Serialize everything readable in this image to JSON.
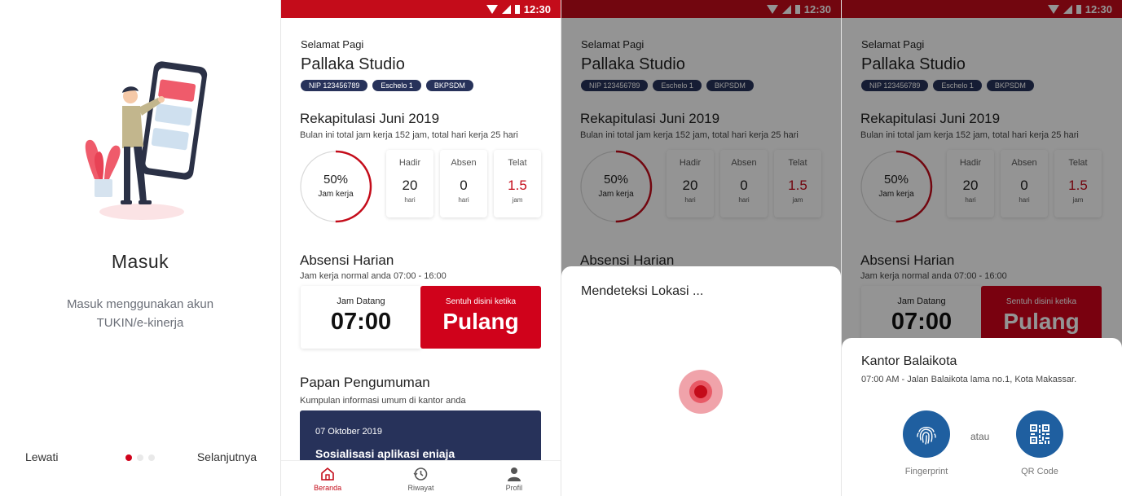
{
  "onboarding": {
    "title": "Masuk",
    "description": "Masuk menggunakan akun TUKIN/e-kinerja",
    "skip_label": "Lewati",
    "next_label": "Selanjutnya",
    "pages_total": 3,
    "current_page": 1
  },
  "status_bar": {
    "time": "12:30"
  },
  "dashboard": {
    "greeting": "Selamat Pagi",
    "user_name": "Pallaka Studio",
    "badges": [
      "NIP 123456789",
      "Eschelo 1",
      "BKPSDM"
    ],
    "recap": {
      "title": "Rekapitulasi Juni 2019",
      "subtitle": "Bulan ini total jam kerja 152 jam, total hari kerja 25 hari",
      "progress_percent": 50,
      "progress_label": "50%",
      "progress_caption": "Jam kerja",
      "stats": [
        {
          "title": "Hadir",
          "value": "20",
          "unit": "hari"
        },
        {
          "title": "Absen",
          "value": "0",
          "unit": "hari"
        },
        {
          "title": "Telat",
          "value": "1.5",
          "unit": "jam"
        }
      ]
    },
    "attendance": {
      "title": "Absensi Harian",
      "subtitle": "Jam kerja normal anda 07:00 - 16:00",
      "arrival_label": "Jam Datang",
      "arrival_time": "07:00",
      "action_hint": "Sentuh disini ketika",
      "action_label": "Pulang"
    },
    "announcements": {
      "title": "Papan Pengumuman",
      "subtitle": "Kumpulan informasi umum di kantor anda",
      "item_date": "07 Oktober 2019",
      "item_title": "Sosialisasi aplikasi eniaja"
    },
    "nav": {
      "home": "Beranda",
      "history": "Riwayat",
      "profile": "Profil"
    }
  },
  "detecting_sheet": {
    "title": "Mendeteksi Lokasi ..."
  },
  "location_sheet": {
    "title": "Kantor Balaikota",
    "subtitle": "07:00 AM - Jalan Balaikota lama no.1, Kota Makassar.",
    "or_label": "atau",
    "fingerprint_label": "Fingerprint",
    "qr_label": "QR Code"
  },
  "colors": {
    "primary_red": "#c40c1a",
    "navy": "#27325a",
    "action_blue": "#1f5fa0"
  }
}
